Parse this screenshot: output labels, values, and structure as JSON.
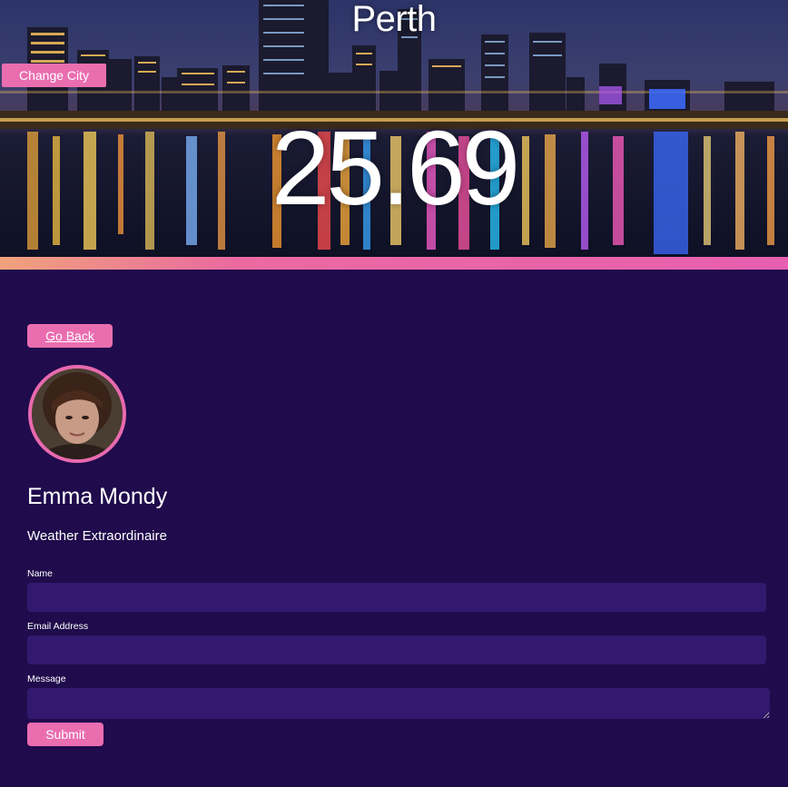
{
  "header": {
    "city": "Perth",
    "temperature": "25.69",
    "change_city_label": "Change City",
    "background_icon": "city-skyline-night-image"
  },
  "profile": {
    "go_back_label": "Go Back",
    "name": "Emma Mondy",
    "role": "Weather Extraordinaire",
    "avatar_icon": "avatar-photo"
  },
  "form": {
    "name_label": "Name",
    "name_value": "",
    "email_label": "Email Address",
    "email_value": "",
    "message_label": "Message",
    "message_value": "",
    "submit_label": "Submit"
  },
  "colors": {
    "page_background": "#200b4c",
    "accent_pink": "#ea6db0",
    "input_background": "#32196f"
  }
}
